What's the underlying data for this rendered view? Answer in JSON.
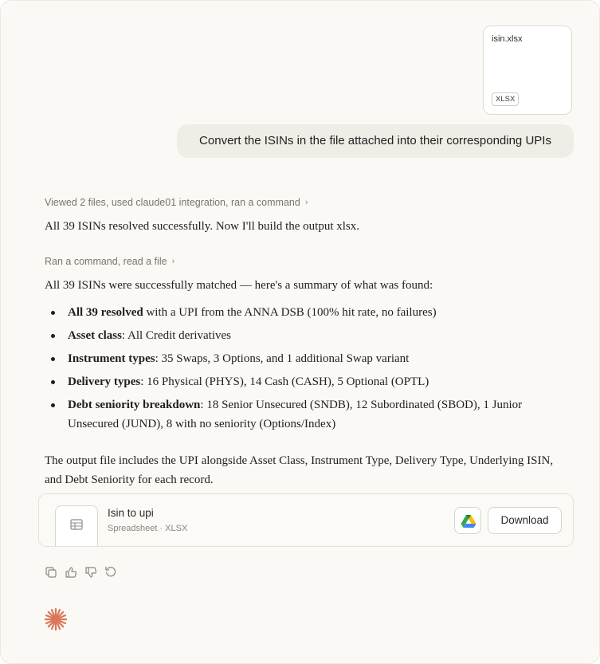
{
  "attachment": {
    "name": "isin.xlsx",
    "badge": "XLSX"
  },
  "user_message": "Convert the ISINs in the file attached into their corresponding UPIs",
  "tool_line_1": "Viewed 2 files, used claude01 integration, ran a command",
  "para_1": "All 39 ISINs resolved successfully. Now I'll build the output xlsx.",
  "tool_line_2": "Ran a command, read a file",
  "para_2": "All 39 ISINs were successfully matched — here's a summary of what was found:",
  "bullets": [
    {
      "bold": "All 39 resolved",
      "rest": " with a UPI from the ANNA DSB (100% hit rate, no failures)"
    },
    {
      "bold": "Asset class",
      "rest": ": All Credit derivatives"
    },
    {
      "bold": "Instrument types",
      "rest": ": 35 Swaps, 3 Options, and 1 additional Swap variant"
    },
    {
      "bold": "Delivery types",
      "rest": ": 16 Physical (PHYS), 14 Cash (CASH), 5 Optional (OPTL)"
    },
    {
      "bold": "Debt seniority breakdown",
      "rest": ": 18 Senior Unsecured (SNDB), 12 Subordinated (SBOD), 1 Junior Unsecured (JUND), 8 with no seniority (Options/Index)"
    }
  ],
  "para_3": "The output file includes the UPI alongside Asset Class, Instrument Type, Delivery Type, Underlying ISIN, and Debt Seniority for each record.",
  "file_card": {
    "title": "Isin to upi",
    "subtitle": "Spreadsheet · XLSX",
    "download_label": "Download"
  },
  "icons": [
    "spreadsheet-icon",
    "google-drive-icon",
    "copy-icon",
    "thumbs-up-icon",
    "thumbs-down-icon",
    "retry-icon",
    "claude-spark-icon"
  ],
  "colors": {
    "accent": "#d97757",
    "background": "#faf9f5",
    "bubble": "#efede6"
  }
}
